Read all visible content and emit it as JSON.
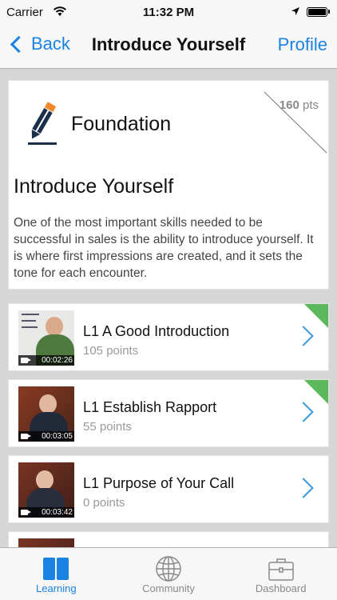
{
  "status_bar": {
    "carrier": "Carrier",
    "time": "11:32 PM"
  },
  "nav": {
    "back_label": "Back",
    "title": "Introduce Yourself",
    "profile_label": "Profile"
  },
  "header": {
    "section_name": "Foundation",
    "points_value": "160",
    "points_unit": "pts",
    "lesson_title": "Introduce Yourself",
    "description": "One of the most important skills needed to be successful in sales is the ability to introduce yourself.  It is where first impressions are created, and it sets the tone for each encounter."
  },
  "lessons": [
    {
      "title": "L1 A Good Introduction",
      "points": "105 points",
      "duration": "00:02:26",
      "completed": true
    },
    {
      "title": "L1 Establish Rapport",
      "points": "55 points",
      "duration": "00:03:05",
      "completed": true
    },
    {
      "title": "L1 Purpose of Your Call",
      "points": "0 points",
      "duration": "00:03:42",
      "completed": false
    }
  ],
  "tabs": [
    {
      "label": "Learning",
      "icon": "book-icon",
      "active": true
    },
    {
      "label": "Community",
      "icon": "globe-icon",
      "active": false
    },
    {
      "label": "Dashboard",
      "icon": "briefcase-icon",
      "active": false
    }
  ],
  "colors": {
    "accent": "#1a82e2",
    "completed_flag": "#5cb85c",
    "arrow": "#3a9ad9"
  }
}
